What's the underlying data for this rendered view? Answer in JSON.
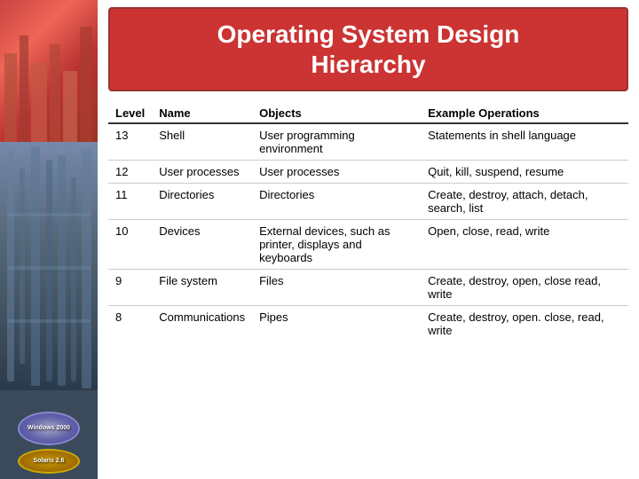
{
  "title": {
    "line1": "Operating System Design",
    "line2": "Hierarchy"
  },
  "table": {
    "headers": [
      "Level",
      "Name",
      "Objects",
      "Example Operations"
    ],
    "rows": [
      {
        "level": "13",
        "name": "Shell",
        "objects": "User programming environment",
        "operations": "Statements in shell language"
      },
      {
        "level": "12",
        "name": "User processes",
        "objects": "User processes",
        "operations": "Quit, kill, suspend, resume"
      },
      {
        "level": "11",
        "name": "Directories",
        "objects": "Directories",
        "operations": "Create, destroy, attach, detach, search, list"
      },
      {
        "level": "10",
        "name": "Devices",
        "objects": "External devices, such as printer, displays and keyboards",
        "operations": "Open, close, read, write"
      },
      {
        "level": "9",
        "name": "File system",
        "objects": "Files",
        "operations": "Create, destroy, open, close read, write"
      },
      {
        "level": "8",
        "name": "Communications",
        "objects": "Pipes",
        "operations": "Create, destroy, open. close, read, write"
      }
    ]
  },
  "sidebar": {
    "win_badge": "Windows 2000",
    "solaris_badge": "Solaris 2.6"
  }
}
